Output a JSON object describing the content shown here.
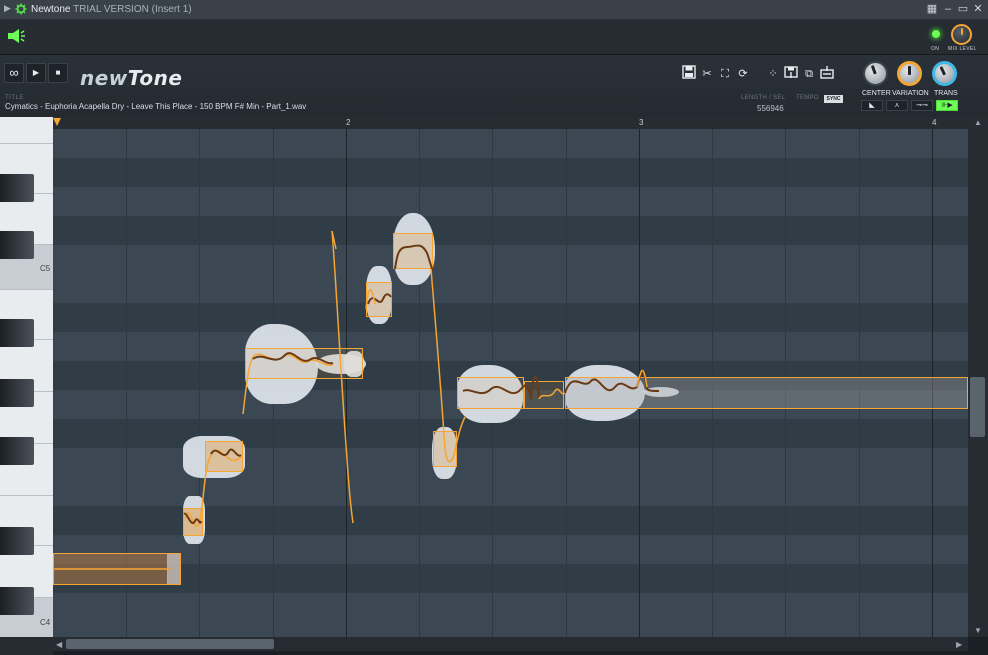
{
  "window": {
    "app_name": "Newtone",
    "trial_label": "TRIAL VERSION (Insert 1)",
    "icons": [
      "menu-arrow-icon",
      "gear-icon",
      "grid-menu-icon",
      "minimize-icon",
      "maximize-icon",
      "close-icon"
    ]
  },
  "topbar": {
    "on_label": "ON",
    "mix_level_label": "MIX LEVEL",
    "on_led_color": "#6dff57",
    "mix_knob_ring_color": "#f4a533"
  },
  "transport": {
    "loop_symbol": "∞",
    "play_symbol": "▶",
    "stop_symbol": "■"
  },
  "logo": {
    "part1": "new",
    "part2": "Tone"
  },
  "file": {
    "title_label": "TITLE",
    "title_value": "Cymatics - Euphoria Acapella Dry - Leave This Place - 150 BPM F# Min - Part_1.wav",
    "length_label": "LENGTH / SEL",
    "length_value": "556946",
    "tempo_label": "TEMPO",
    "sync_label": "SYNC"
  },
  "tools": {
    "icons": [
      "save-icon",
      "cut-icon",
      "select-icon",
      "reset-icon",
      "scatter-icon",
      "save-region-icon",
      "copy-icon",
      "export-icon"
    ]
  },
  "knobs": {
    "center_label": "CENTER",
    "variation_label": "VARIATION",
    "trans_label": "TRANS"
  },
  "modes": {
    "slice_symbol": "◣",
    "pitch_symbol": "⋏",
    "link_symbol": "⊸⊸",
    "active_symbol": "⊪▶"
  },
  "ruler": {
    "bar2": "2",
    "bar3": "3",
    "bar4": "4"
  },
  "keyboard": {
    "c5": "C5",
    "c4": "C4"
  },
  "colors": {
    "accent": "#f4a533",
    "note_fill": "#e6a14d",
    "waveform": "#dfe6ee",
    "active_green": "#6dff57"
  }
}
